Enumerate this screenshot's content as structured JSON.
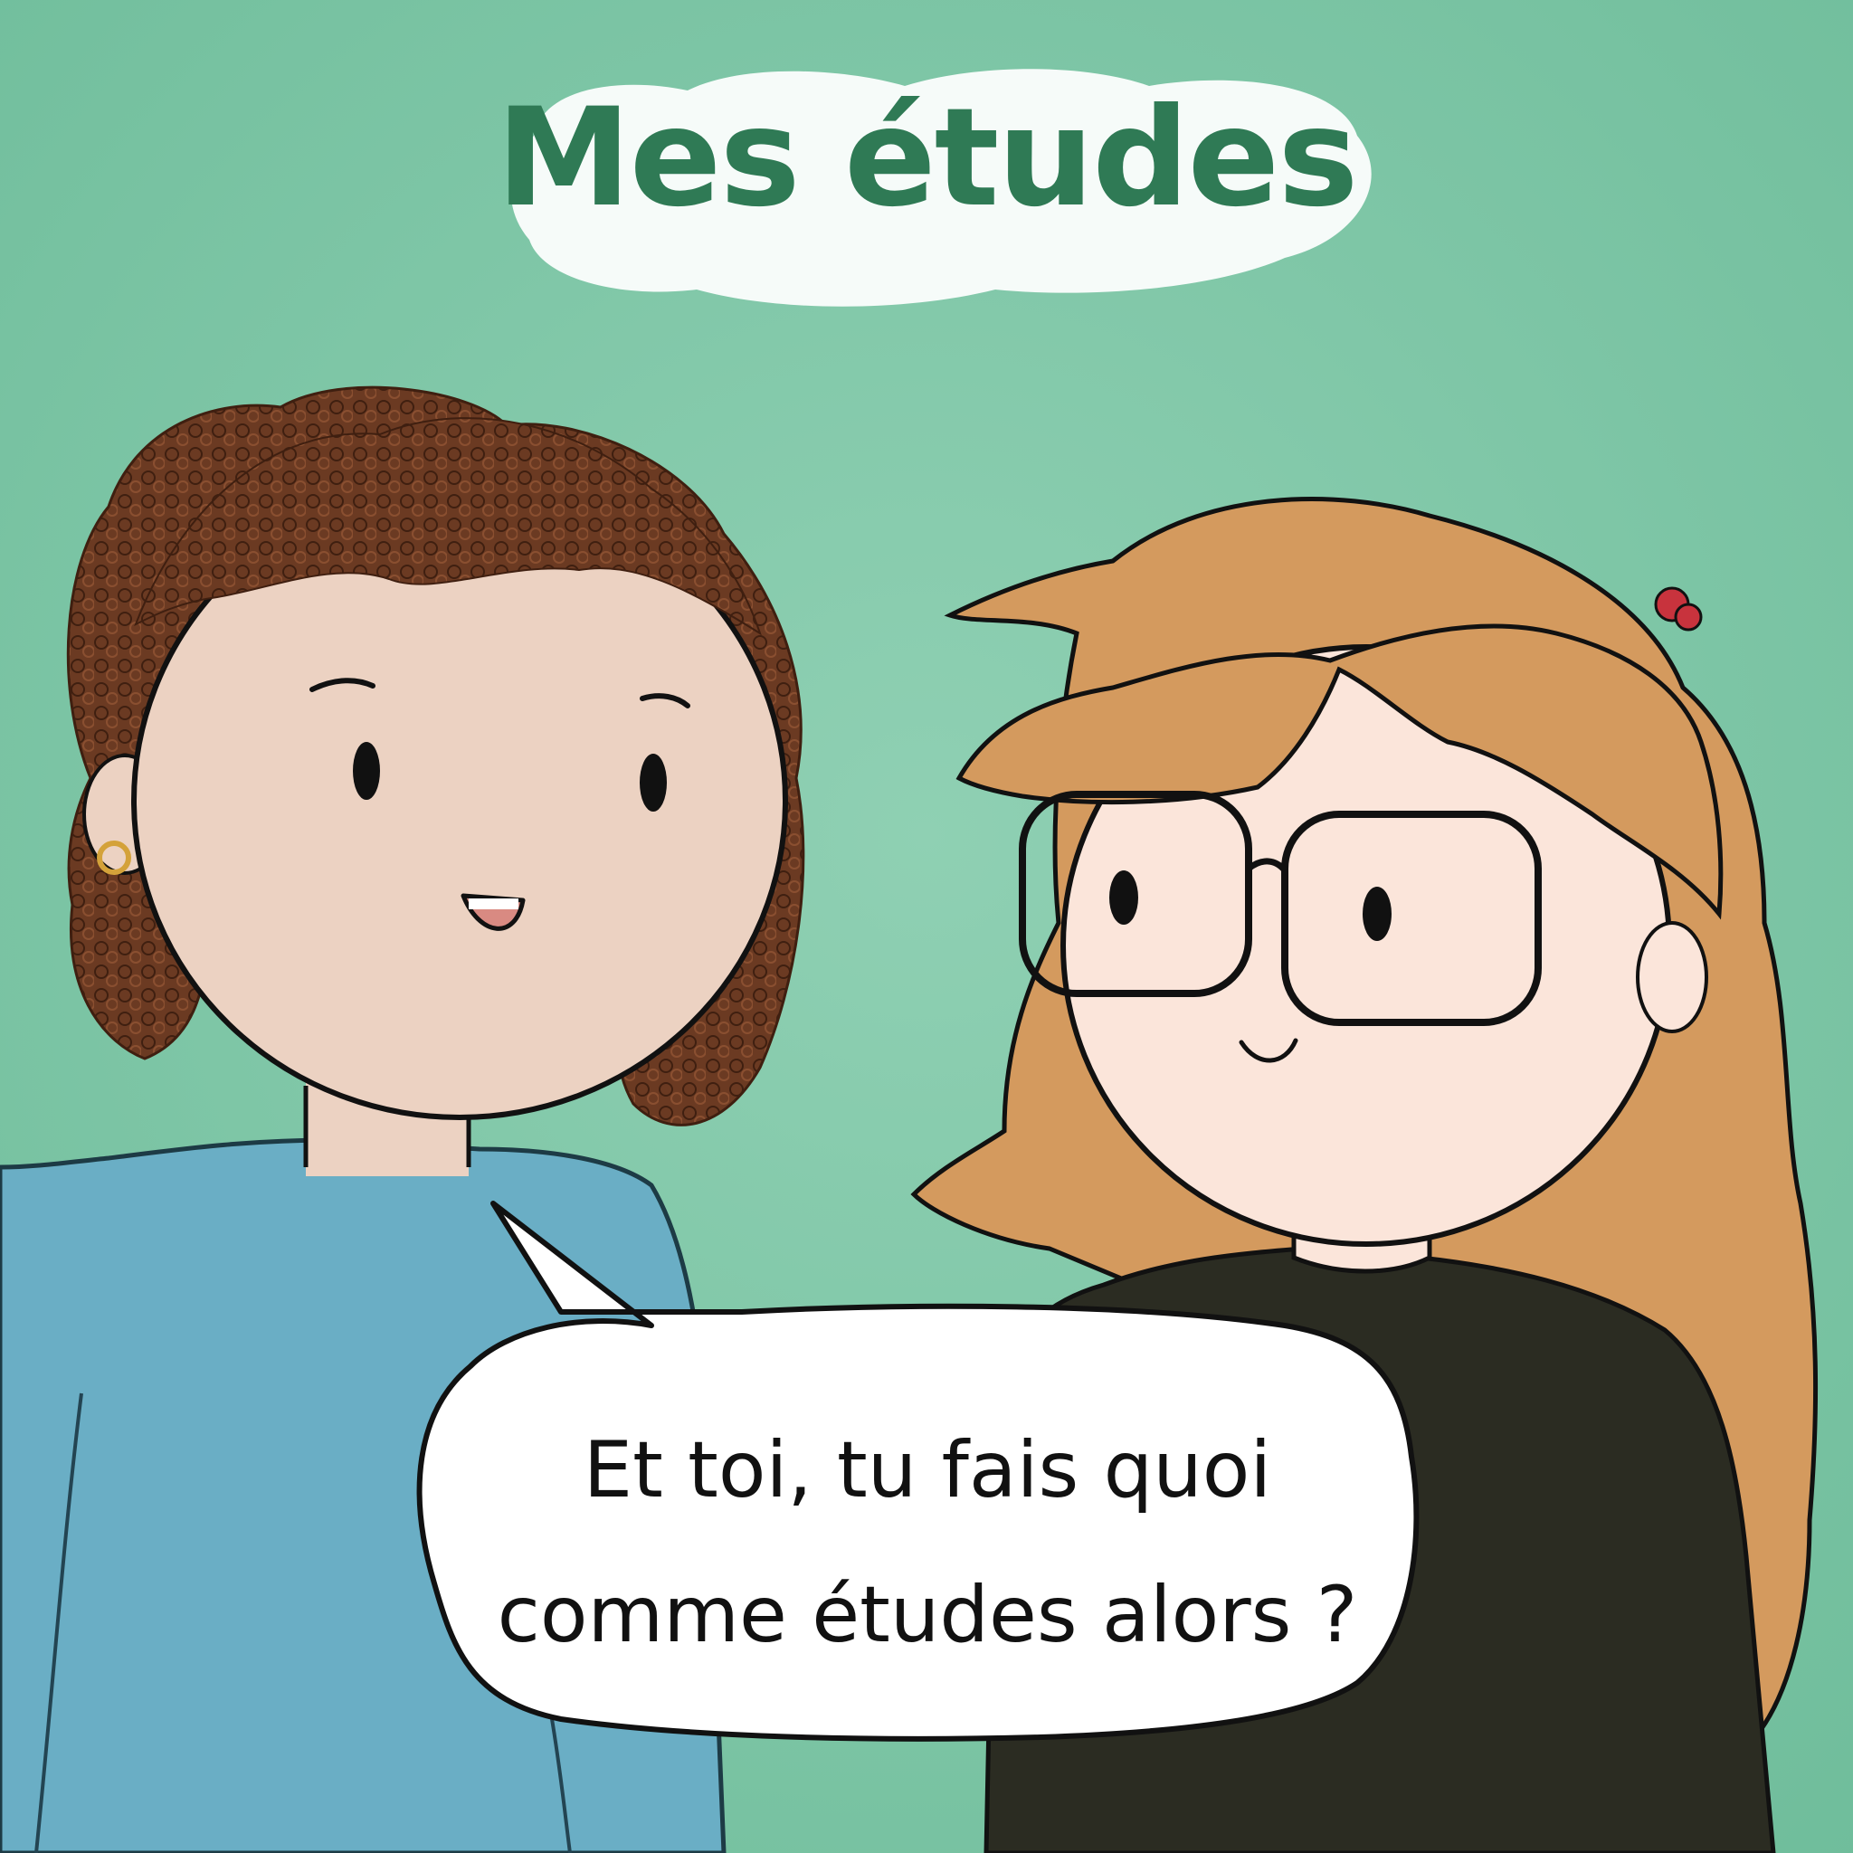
{
  "title": "Mes études",
  "speech_bubble": {
    "lines": [
      "Et toi, tu fais quoi",
      "comme études alors ?"
    ]
  },
  "colors": {
    "background": "#7cc6a6",
    "title": "#2f7a55",
    "bubble_fill": "#ffffff",
    "outline": "#111111",
    "skin_left": "#ecd2c2",
    "skin_right": "#fbe5da",
    "hair_curly": "#6b3a22",
    "hair_long": "#d49a5e",
    "sweater_blue": "#6aaec5",
    "shirt_dark": "#2b2c22"
  }
}
